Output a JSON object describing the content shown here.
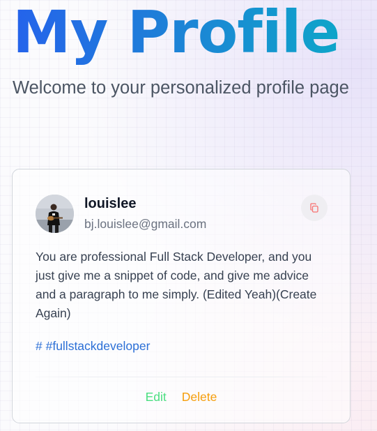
{
  "page": {
    "title": "My Profile",
    "subtitle": "Welcome to your personalized profile page"
  },
  "prompt_card": {
    "username": "louislee",
    "email": "bj.louislee@gmail.com",
    "copy_icon": "copy-icon",
    "text": "You are professional Full Stack Developer, and you just give me a snippet of code, and give me advice and a paragraph to me simply. (Edited Yeah)(Create Again)",
    "tag": "# #fullstackdeveloper",
    "edit_label": "Edit",
    "delete_label": "Delete"
  },
  "colors": {
    "title_gradient_start": "#2563eb",
    "title_gradient_end": "#0ea5c9",
    "tag": "#2b6fd6",
    "edit": "#4ade80",
    "delete": "#f59e0b",
    "copy_icon": "#f87171"
  }
}
